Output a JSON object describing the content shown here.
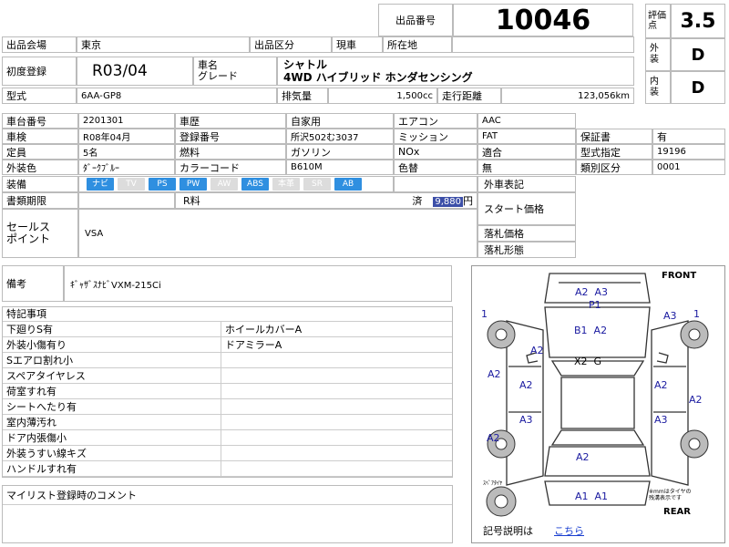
{
  "header": {
    "lot_label": "出品番号",
    "lot_number": "10046",
    "score_label": "評価点",
    "score": "3.5",
    "exterior_label": "外装",
    "exterior": "D",
    "interior_label": "内装",
    "interior": "D"
  },
  "row1": {
    "venue_label": "出品会場",
    "venue": "東京",
    "category_label": "出品区分",
    "category": "現車",
    "location_label": "所在地"
  },
  "row2": {
    "first_reg_label": "初度登録",
    "first_reg": "R03/04",
    "name_label": "車名\nグレード",
    "name": "シャトル",
    "grade": "4WD ハイブリッド ホンダセンシング"
  },
  "row3": {
    "model_label": "型式",
    "model": "6AA-GP8",
    "displacement_label": "排気量",
    "displacement": "1,500cc",
    "mileage_label": "走行距離",
    "mileage": "123,056km"
  },
  "specs": {
    "chassis_label": "車台番号",
    "chassis": "2201301",
    "history_label": "車歴",
    "history": "自家用",
    "ac_label": "エアコン",
    "ac": "AAC",
    "inspection_label": "車検",
    "inspection": "R08年04月",
    "regno_label": "登録番号",
    "regno": "所沢502む3037",
    "mission_label": "ミッション",
    "mission": "FAT",
    "warranty_label": "保証書",
    "warranty": "有",
    "capacity_label": "定員",
    "capacity": "5名",
    "fuel_label": "燃料",
    "fuel": "ガソリン",
    "nox_label": "NOx",
    "nox": "適合",
    "typecert_label": "型式指定",
    "typecert": "19196",
    "color_label": "外装色",
    "color": "ﾀﾞｰｸﾌﾞﾙｰ",
    "colorcode_label": "カラーコード",
    "colorcode": "B610M",
    "colorchange_label": "色替",
    "colorchange": "無",
    "classification_label": "類別区分",
    "classification": "0001",
    "equipment_label": "装備",
    "exterior_note_label": "外車表記",
    "docs_label": "書類期限",
    "recycle_label": "R料",
    "recycle_status": "済",
    "recycle_amount": "9,880",
    "recycle_unit": "円"
  },
  "equipment": [
    {
      "name": "ナビ",
      "on": true
    },
    {
      "name": "TV",
      "on": false
    },
    {
      "name": "PS",
      "on": true
    },
    {
      "name": "PW",
      "on": true
    },
    {
      "name": "AW",
      "on": false
    },
    {
      "name": "ABS",
      "on": true
    },
    {
      "name": "本革",
      "on": false
    },
    {
      "name": "SR",
      "on": false
    },
    {
      "name": "AB",
      "on": true
    }
  ],
  "sales": {
    "label": "セールス\nポイント",
    "value": "VSA",
    "start_price_label": "スタート価格",
    "winning_price_label": "落札価格",
    "winning_form_label": "落札形態"
  },
  "remarks": {
    "label": "備考",
    "value": "ｷﾞｬｻﾞｽﾅﾋﾞVXM-215Ci"
  },
  "notes": {
    "label": "特記事項",
    "rows": [
      {
        "left": "下廻りS有",
        "right": "ホイールカバーA"
      },
      {
        "left": "外装小傷有り",
        "right": "ドアミラーA"
      },
      {
        "left": "Sエアロ割れ小",
        "right": ""
      },
      {
        "left": "スペアタイヤレス",
        "right": ""
      },
      {
        "left": "荷室すれ有",
        "right": ""
      },
      {
        "left": "シートへたり有",
        "right": ""
      },
      {
        "left": "室内薄汚れ",
        "right": ""
      },
      {
        "left": "ドア内張傷小",
        "right": ""
      },
      {
        "left": "外装うすい線キズ",
        "right": ""
      },
      {
        "left": "ハンドルすれ有",
        "right": ""
      }
    ]
  },
  "comment": {
    "label": "マイリスト登録時のコメント"
  },
  "diagram": {
    "front_label": "FRONT",
    "rear_label": "REAR",
    "spare_label": "ｽﾍﾟｱﾀｲﾔ",
    "tire_note": "※mmはタイヤの\n残溝表示です",
    "legend_label": "記号説明は",
    "legend_link": "こちら",
    "marks": {
      "front_top": "A2  A3",
      "front_p": "P1",
      "hood": "B1  A2",
      "roof": "X2  G",
      "fl_wheel": "1",
      "fr_wheel": "A3",
      "fr_num": "1",
      "left_fender": "A2",
      "left_door_front": "A2",
      "left_door_rear": "A3",
      "left_side": "A2",
      "right_door_front": "A2",
      "right_side": "A2",
      "right_door_rear": "A3",
      "rear_quarter": "A2",
      "trunk": "A2",
      "rear_bumper": "A1  A1"
    }
  }
}
